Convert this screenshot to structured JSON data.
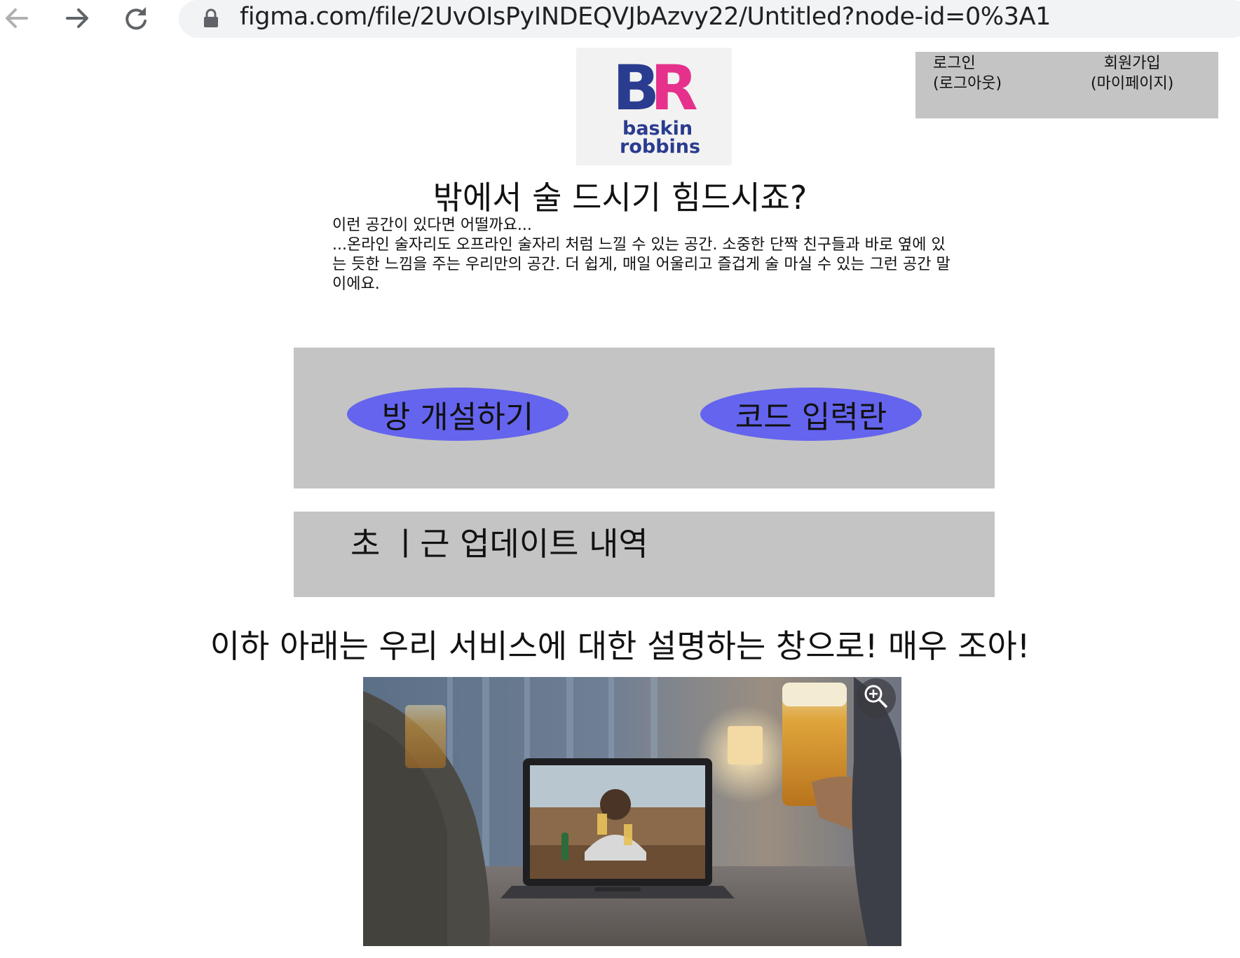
{
  "browser": {
    "url": "figma.com/file/2UvOIsPyINDEQVJbAzvy22/Untitled?node-id=0%3A1",
    "icons": [
      "back-arrow-icon",
      "forward-arrow-icon",
      "reload-icon",
      "lock-icon"
    ]
  },
  "logo": {
    "line1": "BR",
    "line2": "baskin",
    "line3": "robbins",
    "brand_colors": [
      "#2a3c8f",
      "#e5318b"
    ]
  },
  "auth": {
    "login": "로그인",
    "logout": "(로그아웃)",
    "signup": "회원가입",
    "mypage": "(마이페이지)"
  },
  "hero": {
    "title": "밖에서 술 드시기 힘드시죠?",
    "intro_lines": [
      "이런 공간이 있다면 어떨까요...",
      "...온라인 술자리도 오프라인 술자리 처럼 느낄 수 있는 공간. 소중한 단짝 친구들과 바로 옆에 있",
      "는 듯한 느낌을 주는 우리만의 공간. 더 쉽게, 매일 어울리고 즐겁게 술 마실 수 있는 그런 공간 말",
      "이에요."
    ]
  },
  "actions": {
    "create_room": "방 개설하기",
    "enter_code": "코드 입력란",
    "accent": "#6464ee",
    "panel_color": "#c4c4c4"
  },
  "updates": {
    "title": "초 ㅣ근 업데이트 내역"
  },
  "description": {
    "title": "이하 아래는 우리 서비스에 대한 설명하는 창으로! 매우 조아!"
  },
  "photo": {
    "icon": "zoom-in-icon"
  }
}
